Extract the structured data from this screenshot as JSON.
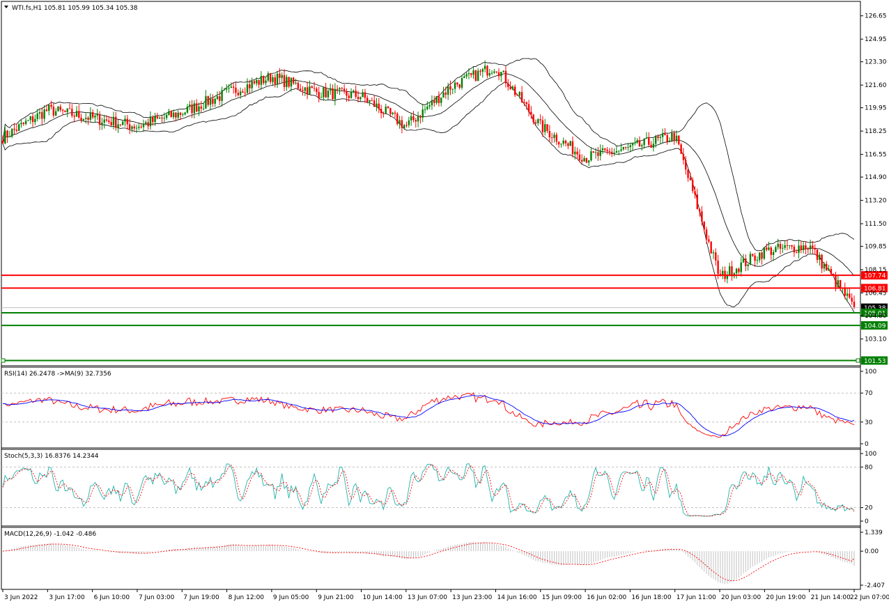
{
  "colors": {
    "bull": "#008000",
    "bear": "#ff0000",
    "band": "#000000",
    "rsi_line": "#ff0000",
    "rsi_ma": "#0000ff",
    "stoch_main": "#20b2aa",
    "stoch_signal": "#ff0000",
    "macd_hist": "#c0c0c0",
    "macd_signal": "#ff0000",
    "level_red": "#ff0000",
    "level_green": "#008000",
    "grid_dash": "#c0c0c0"
  },
  "main": {
    "title": "WTI.fs,H1  105.81 105.99 105.34 105.38",
    "title_icon": "triangle-down-icon",
    "price_ticks": [
      "126.65",
      "124.95",
      "123.30",
      "121.60",
      "119.95",
      "118.25",
      "116.55",
      "114.90",
      "113.20",
      "111.50",
      "109.85",
      "108.15",
      "106.45",
      "104.80",
      "103.10"
    ],
    "level_tags": [
      {
        "label": "107.74",
        "color": "red",
        "value": 107.74
      },
      {
        "label": "106.81",
        "color": "red",
        "value": 106.81
      },
      {
        "label": "105.38",
        "color": "gray",
        "value": 105.38
      },
      {
        "label": "105.01",
        "color": "green",
        "value": 105.01
      },
      {
        "label": "104.09",
        "color": "green",
        "value": 104.09
      },
      {
        "label": "101.53",
        "color": "green",
        "value": 101.53
      }
    ]
  },
  "rsi": {
    "title": "RSI(14) 26.2478   ->MA(9) 32.7356",
    "ticks": [
      "100",
      "70",
      "30",
      "0"
    ]
  },
  "stoch": {
    "title": "Stoch(5,3,3) 16.8376 14.2344",
    "ticks": [
      "100",
      "80",
      "20",
      "0"
    ]
  },
  "macd": {
    "title": "MACD(12,26,9) -1.042 -0.486",
    "ticks": [
      "1.339",
      "0.00",
      "-2.407"
    ]
  },
  "time_labels": [
    "3 Jun 2022",
    "3 Jun 17:00",
    "6 Jun 10:00",
    "7 Jun 03:00",
    "7 Jun 19:00",
    "8 Jun 12:00",
    "9 Jun 05:00",
    "9 Jun 21:00",
    "10 Jun 14:00",
    "13 Jun 07:00",
    "13 Jun 23:00",
    "14 Jun 16:00",
    "15 Jun 09:00",
    "16 Jun 02:00",
    "16 Jun 18:00",
    "17 Jun 11:00",
    "20 Jun 03:00",
    "20 Jun 19:00",
    "21 Jun 14:00",
    "22 Jun 07:00"
  ],
  "chart_data": {
    "type": "candlestick",
    "symbol": "WTI.fs",
    "timeframe": "H1",
    "last_ohlc": {
      "open": 105.81,
      "high": 105.99,
      "low": 105.34,
      "close": 105.38
    },
    "close_anchors": [
      {
        "t": "3 Jun 2022",
        "price": 117.8
      },
      {
        "t": "3 Jun 17:00",
        "price": 119.8
      },
      {
        "t": "6 Jun 10:00",
        "price": 119.2
      },
      {
        "t": "7 Jun 03:00",
        "price": 118.6
      },
      {
        "t": "7 Jun 19:00",
        "price": 119.6
      },
      {
        "t": "8 Jun 12:00",
        "price": 121.0
      },
      {
        "t": "9 Jun 05:00",
        "price": 122.2
      },
      {
        "t": "9 Jun 21:00",
        "price": 121.1
      },
      {
        "t": "10 Jun 14:00",
        "price": 120.8
      },
      {
        "t": "13 Jun 07:00",
        "price": 118.6
      },
      {
        "t": "13 Jun 23:00",
        "price": 121.5
      },
      {
        "t": "14 Jun 16:00",
        "price": 123.0
      },
      {
        "t": "15 Jun 09:00",
        "price": 118.6
      },
      {
        "t": "16 Jun 02:00",
        "price": 116.3
      },
      {
        "t": "16 Jun 18:00",
        "price": 117.0
      },
      {
        "t": "17 Jun 11:00",
        "price": 117.9
      },
      {
        "t": "20 Jun 03:00",
        "price": 107.6
      },
      {
        "t": "20 Jun 19:00",
        "price": 109.5
      },
      {
        "t": "21 Jun 14:00",
        "price": 109.9
      },
      {
        "t": "22 Jun 07:00",
        "price": 105.38
      }
    ],
    "y_range": [
      101.2,
      127.7
    ],
    "levels": {
      "resistance": [
        107.74,
        106.81
      ],
      "support": [
        105.01,
        104.09,
        101.53
      ],
      "current": 105.38
    },
    "indicators": {
      "bollinger": {
        "shown": true
      },
      "rsi": {
        "period": 14,
        "value": 26.2478,
        "ma_period": 9,
        "ma_value": 32.7356,
        "levels": [
          70,
          30
        ],
        "range": [
          0,
          100
        ]
      },
      "stochastic": {
        "params": "5,3,3",
        "k": 16.8376,
        "d": 14.2344,
        "levels": [
          80,
          20
        ],
        "range": [
          0,
          100
        ]
      },
      "macd": {
        "params": "12,26,9",
        "macd": -1.042,
        "signal": -0.486,
        "range": [
          -2.407,
          1.339
        ]
      }
    }
  }
}
